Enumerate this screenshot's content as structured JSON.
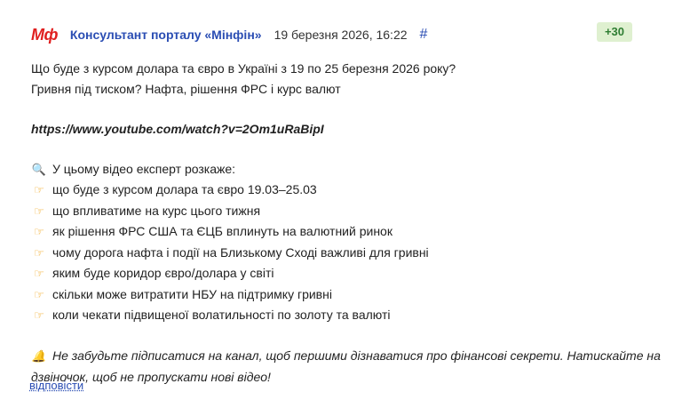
{
  "post": {
    "logo": "Мф",
    "author": "Консультант порталу «Мінфін»",
    "date": "19 березня 2026, 16:22",
    "anchor": "#",
    "score": "+30",
    "title_line1": "Що буде з курсом долара та євро в Україні з 19 по 25 березня 2026 року?",
    "title_line2": "Гривня під тиском? Нафта, рішення ФРС і курс валют",
    "link": "https://www.youtube.com/watch?v=2Om1uRaBipI",
    "intro": "У цьому відео експерт розкаже:",
    "intro_icon": "magnifier-icon",
    "bullet_icon": "pointing-hand-icon",
    "bullets": [
      "що буде з курсом долара та євро 19.03–25.03",
      "що впливатиме на курс цього тижня",
      "як рішення ФРС США та ЄЦБ вплинуть на валютний ринок",
      "чому дорога нафта і події на Близькому Сході важливі для гривні",
      "яким буде коридор євро/долара у світі",
      "скільки може витратити НБУ на підтримку гривні",
      "коли чекати підвищеної волатильності по золоту та валюті"
    ],
    "note_icon": "bell-icon",
    "note": "Не забудьте підписатися на канал, щоб першими дізнаватися про фінансові секрети. Натискайте на дзвіночок, щоб не пропускати нові відео!",
    "reply": "відповісти"
  },
  "colors": {
    "author": "#2a4db3",
    "logo": "#e02020",
    "score_bg": "#dff0d0",
    "score_text": "#2e7d32"
  }
}
